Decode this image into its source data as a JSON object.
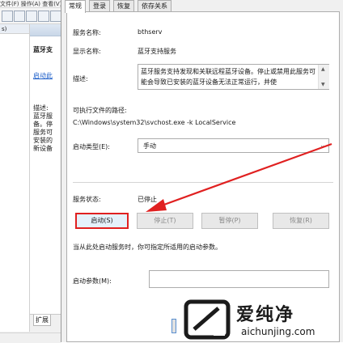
{
  "background_window": {
    "menubar_text": "文件(F)  操作(A)  查看(V)",
    "tree_header": "s)",
    "detail_title": "蓝牙支",
    "start_link": "启动此",
    "desc_label": "描述:",
    "desc_lines": [
      "蓝牙服",
      "备。停",
      "服务可",
      "安装的",
      "新设备"
    ],
    "bottom_tab": "扩展"
  },
  "dialog": {
    "tabs": [
      "常规",
      "登录",
      "恢复",
      "依存关系"
    ],
    "service_name_label": "服务名称:",
    "service_name_value": "bthserv",
    "display_name_label": "显示名称:",
    "display_name_value": "蓝牙支持服务",
    "description_label": "描述:",
    "description_value": "蓝牙服务支持发现和关联远程蓝牙设备。停止或禁用此服务可能会导致已安装的蓝牙设备无法正常运行，并使",
    "exec_path_label": "可执行文件的路径:",
    "exec_path_value": "C:\\Windows\\system32\\svchost.exe -k LocalService",
    "startup_type_label": "启动类型(E):",
    "startup_type_value": "手动",
    "status_label": "服务状态:",
    "status_value": "已停止",
    "buttons": {
      "start": "启动(S)",
      "stop": "停止(T)",
      "pause": "暂停(P)",
      "resume": "恢复(R)"
    },
    "hint_text": "当从此处启动服务时，你可指定所适用的启动参数。",
    "start_params_label": "启动参数(M):"
  },
  "annotation": {
    "arrow_color": "#e02020"
  },
  "watermark": {
    "brand": "爱纯净",
    "url": "aichunjing.com"
  }
}
